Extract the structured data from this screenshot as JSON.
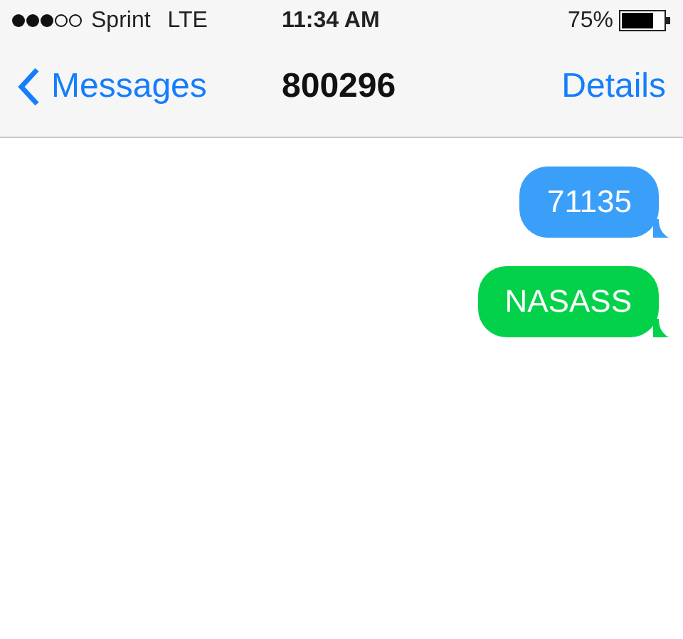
{
  "status_bar": {
    "carrier": "Sprint",
    "network": "LTE",
    "time": "11:34 AM",
    "battery": "75%"
  },
  "nav_bar": {
    "back": "Messages",
    "title": "800296",
    "action": "Details"
  },
  "messages": [
    {
      "text": "71135",
      "color": "#3a9ff8"
    },
    {
      "text": "NASASS",
      "color": "#04d14a"
    }
  ]
}
